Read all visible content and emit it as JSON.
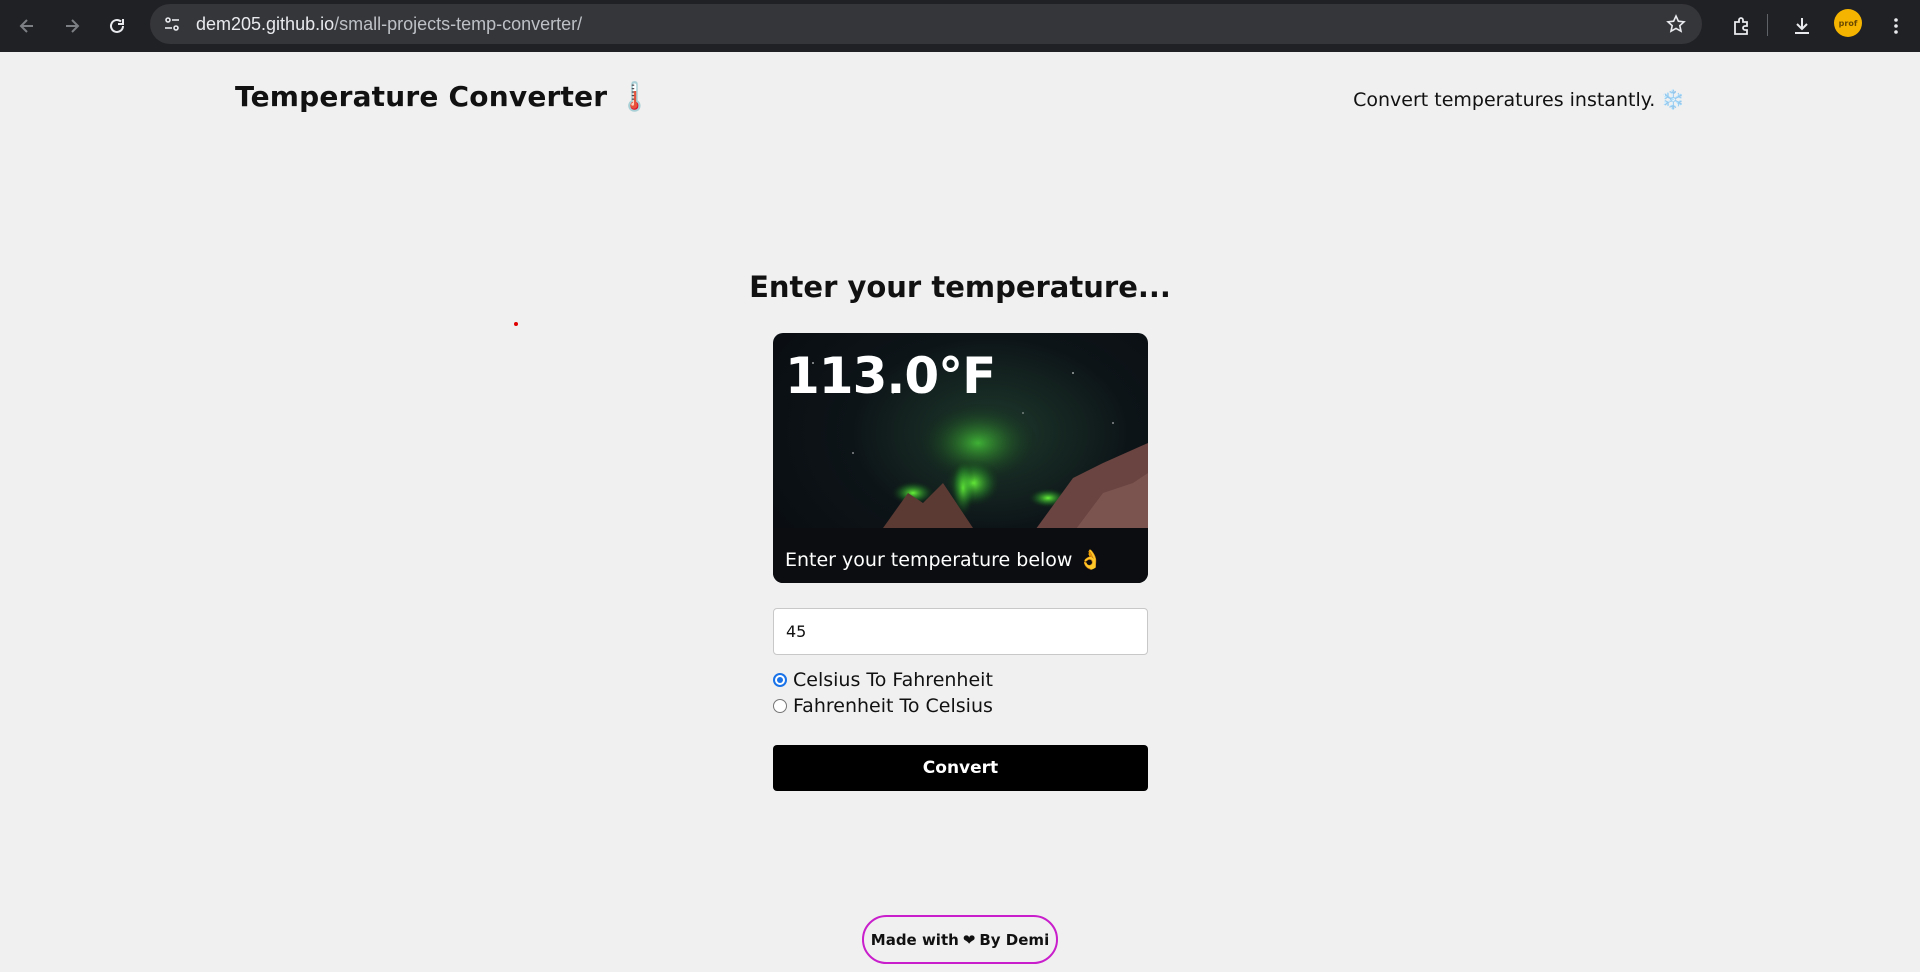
{
  "browser": {
    "url_host": "dem205.github.io",
    "url_path": "/small-projects-temp-converter/",
    "profile_label": "prof"
  },
  "header": {
    "title": "Temperature Converter 🌡️",
    "tagline": "Convert temperatures instantly. ❄️"
  },
  "main": {
    "heading": "Enter your temperature...",
    "result": "113.0°F",
    "hint": "Enter your temperature below 👌",
    "input_value": "45",
    "options": [
      {
        "label": "Celsius To Fahrenheit",
        "checked": true
      },
      {
        "label": "Fahrenheit To Celsius",
        "checked": false
      }
    ],
    "convert_label": "Convert"
  },
  "footer": {
    "made_with": "Made with",
    "heart": "❤",
    "by": "By Demi"
  },
  "colors": {
    "chrome_bg": "#202124",
    "page_bg": "#f0f0f0",
    "button_bg": "#000000",
    "badge_border": "#c81ecb",
    "radio_accent": "#1a73e8"
  },
  "icons": [
    "back-icon",
    "forward-icon",
    "reload-icon",
    "site-info-icon",
    "star-icon",
    "extensions-icon",
    "download-icon",
    "menu-icon"
  ]
}
